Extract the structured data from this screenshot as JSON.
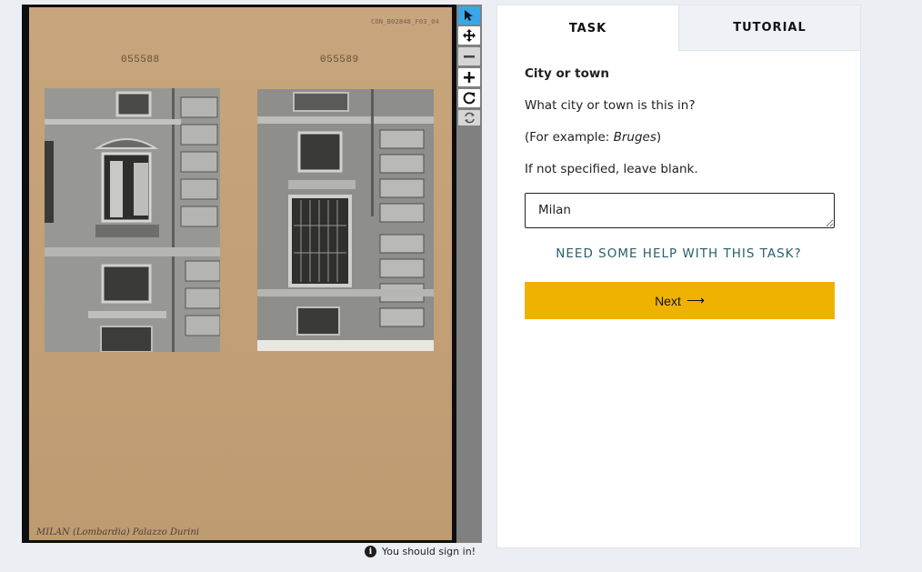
{
  "subject": {
    "card_reference": "CON_B02848_F03_04",
    "photo_numbers": [
      "055588",
      "055589"
    ],
    "handwritten_caption": "MILAN (Lombardia) Palazzo Durini"
  },
  "toolbar": {
    "tools": [
      {
        "name": "select-icon",
        "active": true
      },
      {
        "name": "move-icon"
      },
      {
        "name": "zoom-out-icon",
        "disabled": true
      },
      {
        "name": "zoom-in-icon"
      },
      {
        "name": "rotate-icon"
      },
      {
        "name": "reset-icon",
        "disabled": true
      }
    ]
  },
  "signin_notice": "You should sign in!",
  "tabs": {
    "task": "TASK",
    "tutorial": "TUTORIAL"
  },
  "task": {
    "title": "City or town",
    "question": "What city or town is this in?",
    "example_prefix": "(For example: ",
    "example_value": "Bruges",
    "example_suffix": ")",
    "note": "If not specified, leave blank.",
    "answer_value": "Milan",
    "help_link": "NEED SOME HELP WITH THIS TASK?",
    "next_label": "Next",
    "next_arrow": "⟶"
  },
  "colors": {
    "accent": "#f0b200",
    "active_tool": "#37a7e8",
    "help_link": "#2a5f6b"
  }
}
